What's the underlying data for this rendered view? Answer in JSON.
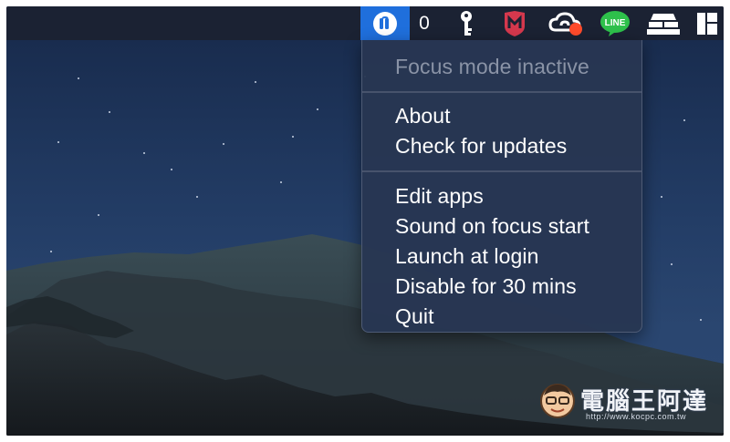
{
  "menubar": {
    "focus_app_icon": "focus-app-icon",
    "count_value": "0",
    "icons": [
      "focus-app-icon",
      "key-icon",
      "mcafee-icon",
      "creative-cloud-icon",
      "line-icon",
      "stack-icon",
      "layout-icon"
    ],
    "active_color": "#1f6fdc"
  },
  "menu": {
    "status_label": "Focus mode inactive",
    "section_one": [
      "About",
      "Check for updates"
    ],
    "section_two": [
      "Edit apps",
      "Sound on focus start",
      "Launch at login",
      "Disable for 30 mins",
      "Quit"
    ]
  },
  "watermark": {
    "title": "電腦王阿達",
    "url": "http://www.kocpc.com.tw"
  },
  "colors": {
    "menubar_bg": "#1b2233",
    "menu_bg": "#283652",
    "line_green": "#2ec04b",
    "mcafee_red": "#d5384d",
    "notification_red": "#ff4b2b"
  }
}
